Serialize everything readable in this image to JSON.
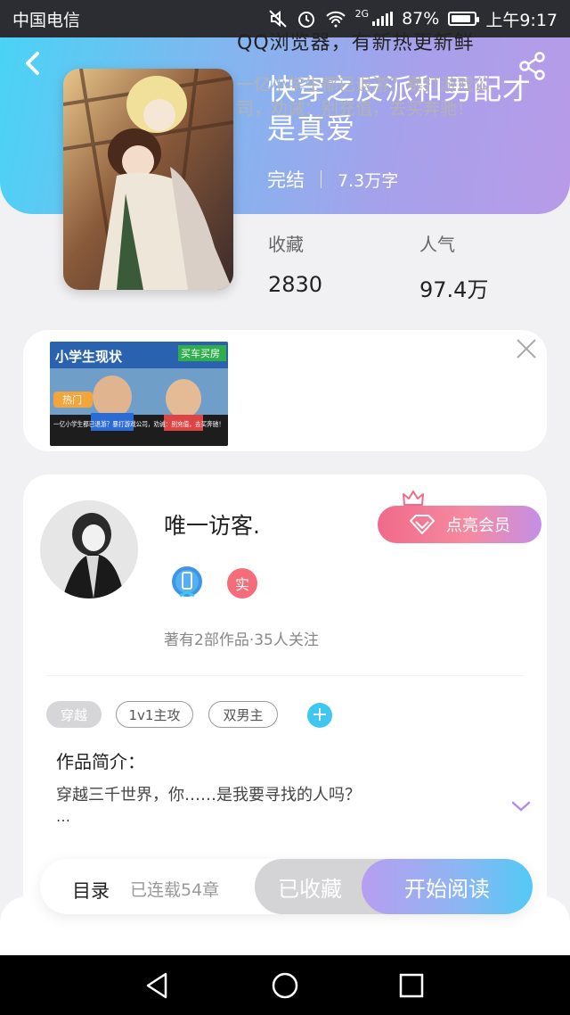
{
  "status_bar": {
    "carrier": "中国电信",
    "network": "2G",
    "battery": "87%",
    "battery_level": 0.87,
    "time": "上午9:17"
  },
  "book": {
    "title": "快穿之反派和男配才是真爱",
    "status": "完结",
    "word_count": "7.3万字",
    "favorites_label": "收藏",
    "favorites_value": "2830",
    "popularity_label": "人气",
    "popularity_value": "97.4万"
  },
  "ad": {
    "title": "QQ浏览器，有新热更新鲜",
    "description": "一亿小学生都已退游？暴打游戏公司，劝诫：别充值，去买奔驰！",
    "thumb_headline": "小学生现状",
    "thumb_tag": "买车买房",
    "thumb_hot": "热门",
    "thumb_caption": "一亿小学生都已退游？暴打游戏公司，劝诫：别充值，去买奔驰！"
  },
  "author": {
    "name": "唯一访客.",
    "vip_label": "点亮会员",
    "real_badge": "实",
    "works_info": "著有2部作品·35人关注"
  },
  "tags": [
    "穿越",
    "1v1主攻",
    "双男主"
  ],
  "tag_add": "+",
  "intro": {
    "title": "作品简介：",
    "text": "穿越三千世界，你……是我要寻找的人吗？",
    "ellipsis": "…"
  },
  "actions": {
    "toc_label": "目录",
    "serial_label": "已连载54章",
    "collected_label": "已收藏",
    "read_label": "开始阅读"
  },
  "icons": {
    "back": "back-icon",
    "share": "share-icon",
    "close": "close-icon",
    "crown": "crown-icon",
    "diamond": "diamond-icon",
    "expand": "chevron-down-icon"
  },
  "colors": {
    "header_gradient_start": "#49d3f5",
    "header_gradient_end": "#b89be8",
    "vip_gradient_start": "#f06a8a",
    "vip_gradient_end": "#c48fe8",
    "read_gradient_start": "#b79ef0",
    "read_gradient_end": "#52c9f5"
  }
}
